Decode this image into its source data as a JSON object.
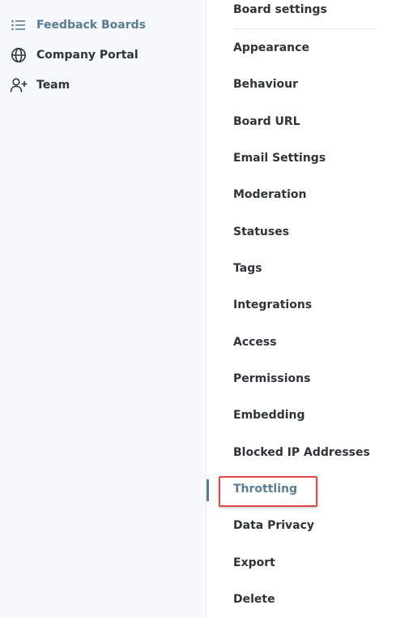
{
  "sidebar": {
    "items": [
      {
        "label": "Feedback Boards",
        "icon": "list-icon",
        "active": true
      },
      {
        "label": "Company Portal",
        "icon": "globe-icon",
        "active": false
      },
      {
        "label": "Team",
        "icon": "add-user-icon",
        "active": false
      }
    ]
  },
  "settings_nav": {
    "title": "Board settings",
    "items": [
      {
        "label": "Appearance"
      },
      {
        "label": "Behaviour"
      },
      {
        "label": "Board URL"
      },
      {
        "label": "Email Settings"
      },
      {
        "label": "Moderation"
      },
      {
        "label": "Statuses"
      },
      {
        "label": "Tags"
      },
      {
        "label": "Integrations"
      },
      {
        "label": "Access"
      },
      {
        "label": "Permissions"
      },
      {
        "label": "Embedding"
      },
      {
        "label": "Blocked IP Addresses"
      },
      {
        "label": "Throttling"
      },
      {
        "label": "Data Privacy"
      },
      {
        "label": "Export"
      },
      {
        "label": "Delete"
      }
    ],
    "active_label": "Throttling"
  },
  "colors": {
    "text": "#2f3437",
    "active": "#5b7b93",
    "sidebar_bg": "#f5f9fc",
    "highlight": "#e0474c"
  }
}
